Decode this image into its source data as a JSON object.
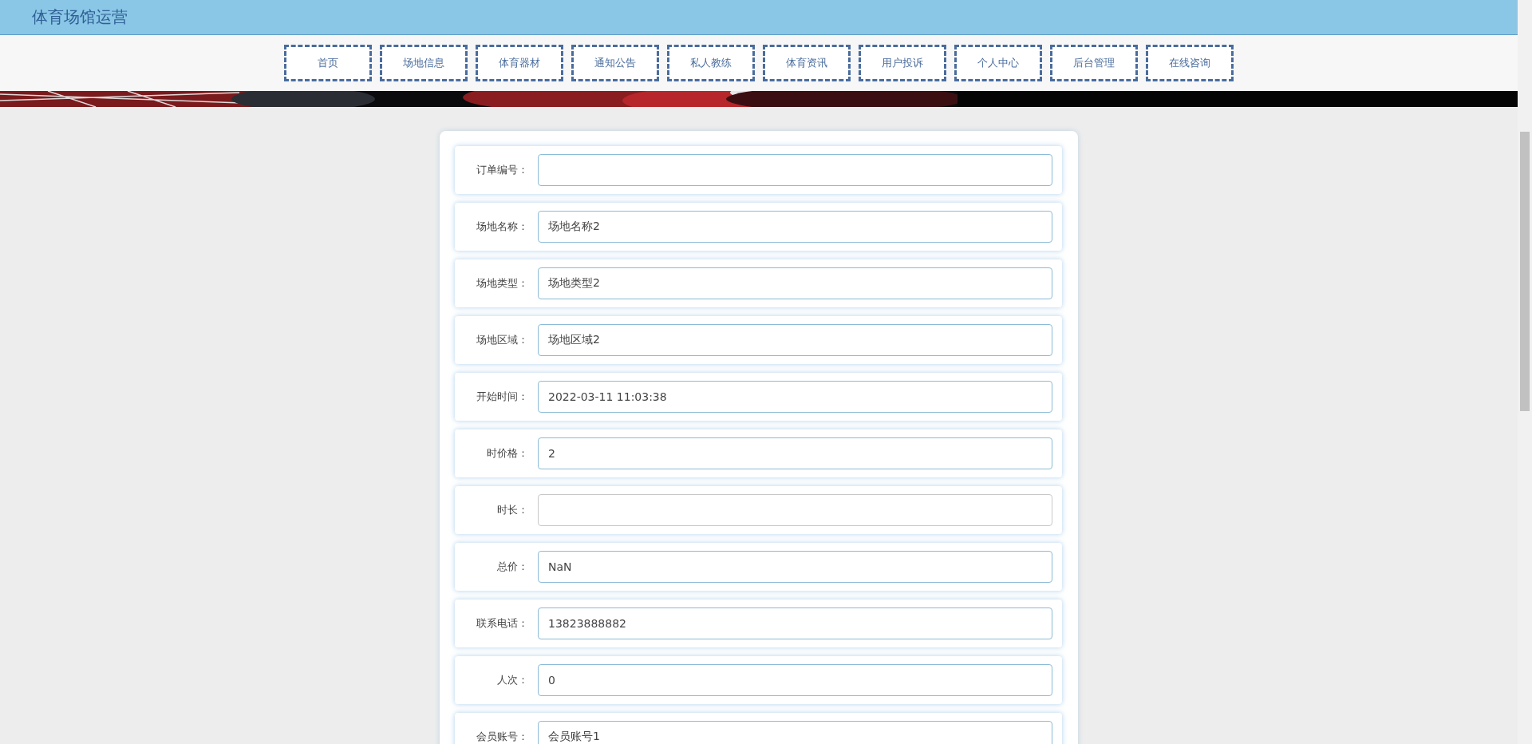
{
  "header": {
    "title": "体育场馆运营"
  },
  "nav": [
    {
      "label": "首页"
    },
    {
      "label": "场地信息"
    },
    {
      "label": "体育器材"
    },
    {
      "label": "通知公告"
    },
    {
      "label": "私人教练"
    },
    {
      "label": "体育资讯"
    },
    {
      "label": "用户投诉"
    },
    {
      "label": "个人中心"
    },
    {
      "label": "后台管理"
    },
    {
      "label": "在线咨询"
    }
  ],
  "form": {
    "fields": [
      {
        "label": "订单编号：",
        "focused": false
      },
      {
        "label": "场地名称：",
        "value": "场地名称2",
        "focused": false
      },
      {
        "label": "场地类型：",
        "value": "场地类型2",
        "focused": false
      },
      {
        "label": "场地区域：",
        "value": "场地区域2",
        "focused": false
      },
      {
        "label": "开始时间：",
        "value": "2022-03-11 11:03:38",
        "focused": false
      },
      {
        "label": "时价格：",
        "value": "2",
        "focused": false
      },
      {
        "label": "时长：",
        "focused": true
      },
      {
        "label": "总价：",
        "value": "NaN",
        "focused": false
      },
      {
        "label": "联系电话：",
        "value": "13823888882",
        "focused": false
      },
      {
        "label": "人次：",
        "value": "0",
        "focused": false
      },
      {
        "label": "会员账号：",
        "value": "会员账号1",
        "focused": false
      }
    ]
  }
}
